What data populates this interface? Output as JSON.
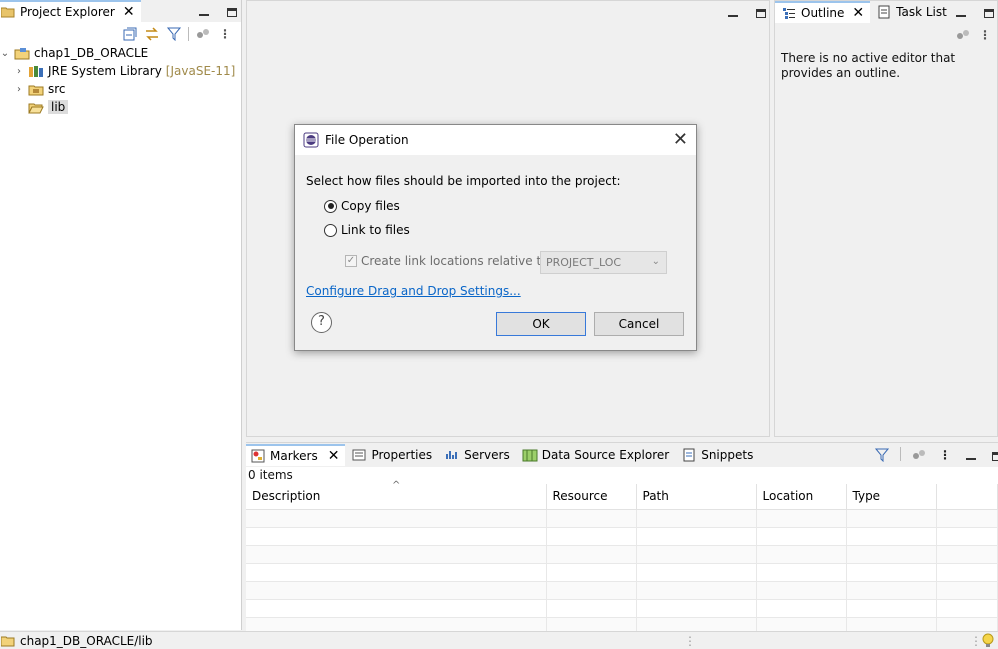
{
  "project_explorer": {
    "title": "Project Explorer",
    "tree": [
      {
        "label": "chap1_DB_ORACLE",
        "decoration": "",
        "expanded": true,
        "level": 0
      },
      {
        "label": "JRE System Library",
        "decoration": "[JavaSE-11]",
        "expanded": false,
        "level": 1
      },
      {
        "label": "src",
        "decoration": "",
        "expanded": false,
        "level": 1
      },
      {
        "label": "lib",
        "decoration": "",
        "expanded": false,
        "level": 1,
        "selected": true
      }
    ]
  },
  "outline": {
    "tab_outline": "Outline",
    "tab_tasklist": "Task List",
    "message": "There is no active editor that provides an outline."
  },
  "bottom": {
    "tabs": [
      "Markers",
      "Properties",
      "Servers",
      "Data Source Explorer",
      "Snippets"
    ],
    "items_count": "0 items",
    "columns": [
      "Description",
      "Resource",
      "Path",
      "Location",
      "Type"
    ]
  },
  "status": {
    "path": "chap1_DB_ORACLE/lib"
  },
  "dialog": {
    "title": "File Operation",
    "prompt": "Select how files should be imported into the project:",
    "option_copy": "Copy files",
    "option_link": "Link to files",
    "selected_option": "copy",
    "create_link_label": "Create link locations relative to:",
    "create_link_checked": true,
    "relative_to_value": "PROJECT_LOC",
    "configure_link": "Configure Drag and Drop Settings...",
    "ok_label": "OK",
    "cancel_label": "Cancel"
  },
  "colors": {
    "accent": "#3879d9",
    "link": "#0a66c8",
    "tab_highlight": "#9cc4ec"
  }
}
